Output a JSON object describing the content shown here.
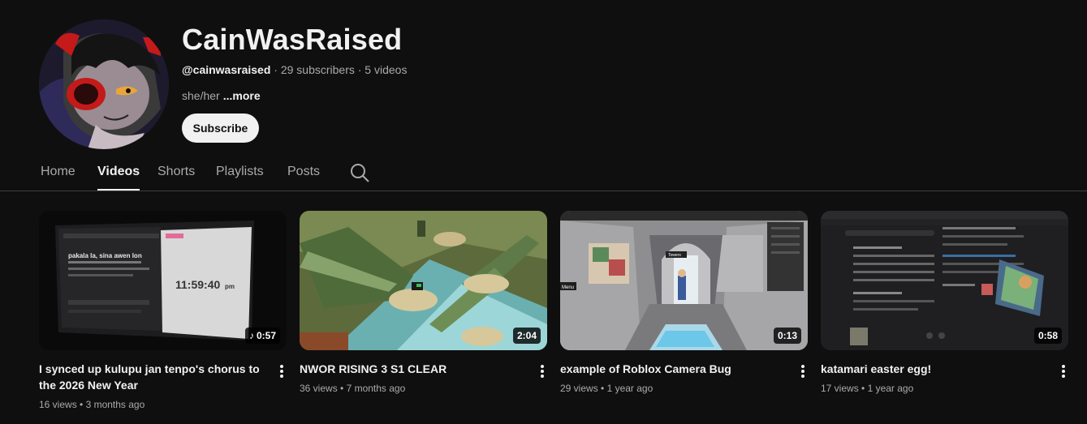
{
  "channel": {
    "name": "CainWasRaised",
    "handle": "@cainwasraised",
    "stats": " · 29 subscribers · 5 videos",
    "description": "she/her",
    "more_label": "...more",
    "subscribe_label": "Subscribe"
  },
  "tabs": [
    {
      "label": "Home"
    },
    {
      "label": "Videos"
    },
    {
      "label": "Shorts"
    },
    {
      "label": "Playlists"
    },
    {
      "label": "Posts"
    }
  ],
  "active_tab": "Videos",
  "videos": [
    {
      "title": "I synced up kulupu jan tenpo's chorus to the 2026 New Year",
      "duration": "0:57",
      "views": "16 views",
      "age": "3 months ago",
      "screen_clock": "11:59:40",
      "screen_clock_suffix": "pm",
      "screen_heading": "pakala la, sina awen lon",
      "short_badge": true
    },
    {
      "title": "NWOR RISING 3 S1 CLEAR",
      "duration": "2:04",
      "views": "36 views",
      "age": "7 months ago"
    },
    {
      "title": "example of Roblox Camera Bug",
      "duration": "0:13",
      "views": "29 views",
      "age": "1 year ago",
      "game_label": "Menu",
      "tower_label": "Towers"
    },
    {
      "title": "katamari easter egg!",
      "duration": "0:58",
      "views": "17 views",
      "age": "1 year ago"
    }
  ],
  "colors": {
    "background": "#0f0f0f",
    "text_primary": "#f1f1f1",
    "text_secondary": "#aaaaaa",
    "subscribe_bg": "#f1f1f1"
  }
}
